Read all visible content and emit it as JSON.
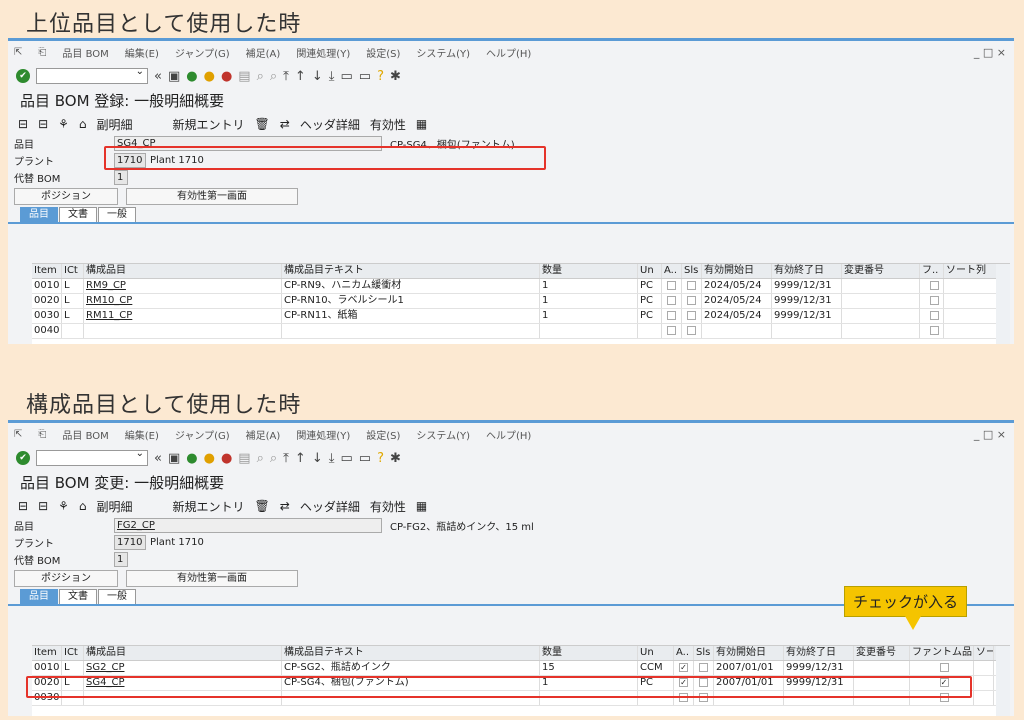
{
  "top": {
    "heading": "上位品目として使用した時",
    "menu": [
      "品目 BOM",
      "編集(E)",
      "ジャンプ(G)",
      "補足(A)",
      "関連処理(Y)",
      "設定(S)",
      "システム(Y)",
      "ヘルプ(H)"
    ],
    "title": "品目 BOM 登録: 一般明細概要",
    "toolbar2": {
      "sub": "副明細",
      "new_entry": "新規エントリ",
      "header_detail": "ヘッダ詳細",
      "validity": "有効性"
    },
    "fields": {
      "material_label": "品目",
      "material_value": "SG4_CP",
      "material_desc": "CP-SG4、梱包(ファントム)",
      "plant_label": "プラント",
      "plant_value": "1710",
      "plant_desc": "Plant 1710",
      "alt_label": "代替 BOM",
      "alt_value": "1"
    },
    "buttons": {
      "position": "ポジション",
      "validity_first": "有効性第一画面"
    },
    "tabs": [
      "品目",
      "文書",
      "一般"
    ],
    "columns": [
      "Item",
      "ICt",
      "構成品目",
      "構成品目テキスト",
      "数量",
      "Un",
      "A..",
      "Sls",
      "有効開始日",
      "有効終了日",
      "変更番号",
      "フ..",
      "ソート列"
    ],
    "rows": [
      {
        "item": "0010",
        "ict": "L",
        "comp": "RM9_CP",
        "text": "CP-RN9、ハニカム緩衝材",
        "qty": "1",
        "un": "PC",
        "a": false,
        "from": "2024/05/24",
        "to": "9999/12/31",
        "ph": false
      },
      {
        "item": "0020",
        "ict": "L",
        "comp": "RM10_CP",
        "text": "CP-RN10、ラベルシール1",
        "qty": "1",
        "un": "PC",
        "a": false,
        "from": "2024/05/24",
        "to": "9999/12/31",
        "ph": false
      },
      {
        "item": "0030",
        "ict": "L",
        "comp": "RM11_CP",
        "text": "CP-RN11、紙箱",
        "qty": "1",
        "un": "PC",
        "a": false,
        "from": "2024/05/24",
        "to": "9999/12/31",
        "ph": false
      },
      {
        "item": "0040",
        "ict": "",
        "comp": "",
        "text": "",
        "qty": "",
        "un": "",
        "a": false,
        "from": "",
        "to": "",
        "ph": false
      }
    ]
  },
  "bottom": {
    "heading": "構成品目として使用した時",
    "title": "品目 BOM 変更: 一般明細概要",
    "fields": {
      "material_value": "FG2_CP",
      "material_desc": "CP-FG2、瓶詰めインク、15 ml"
    },
    "callout": "チェックが入る",
    "columns": [
      "Item",
      "ICt",
      "構成品目",
      "構成品目テキスト",
      "数量",
      "Un",
      "A..",
      "Sls",
      "有効開始日",
      "有効終了日",
      "変更番号",
      "ファントム品目",
      "ソー"
    ],
    "rows": [
      {
        "item": "0010",
        "ict": "L",
        "comp": "SG2_CP",
        "text": "CP-SG2、瓶詰めインク",
        "qty": "15",
        "un": "CCM",
        "a": true,
        "from": "2007/01/01",
        "to": "9999/12/31",
        "ph": false
      },
      {
        "item": "0020",
        "ict": "L",
        "comp": "SG4_CP",
        "text": "CP-SG4、梱包(ファントム)",
        "qty": "1",
        "un": "PC",
        "a": true,
        "from": "2007/01/01",
        "to": "9999/12/31",
        "ph": true
      },
      {
        "item": "0030",
        "ict": "",
        "comp": "",
        "text": "",
        "qty": "",
        "un": "",
        "a": false,
        "from": "",
        "to": "",
        "ph": false
      }
    ]
  },
  "window_controls": "_ □ ×"
}
